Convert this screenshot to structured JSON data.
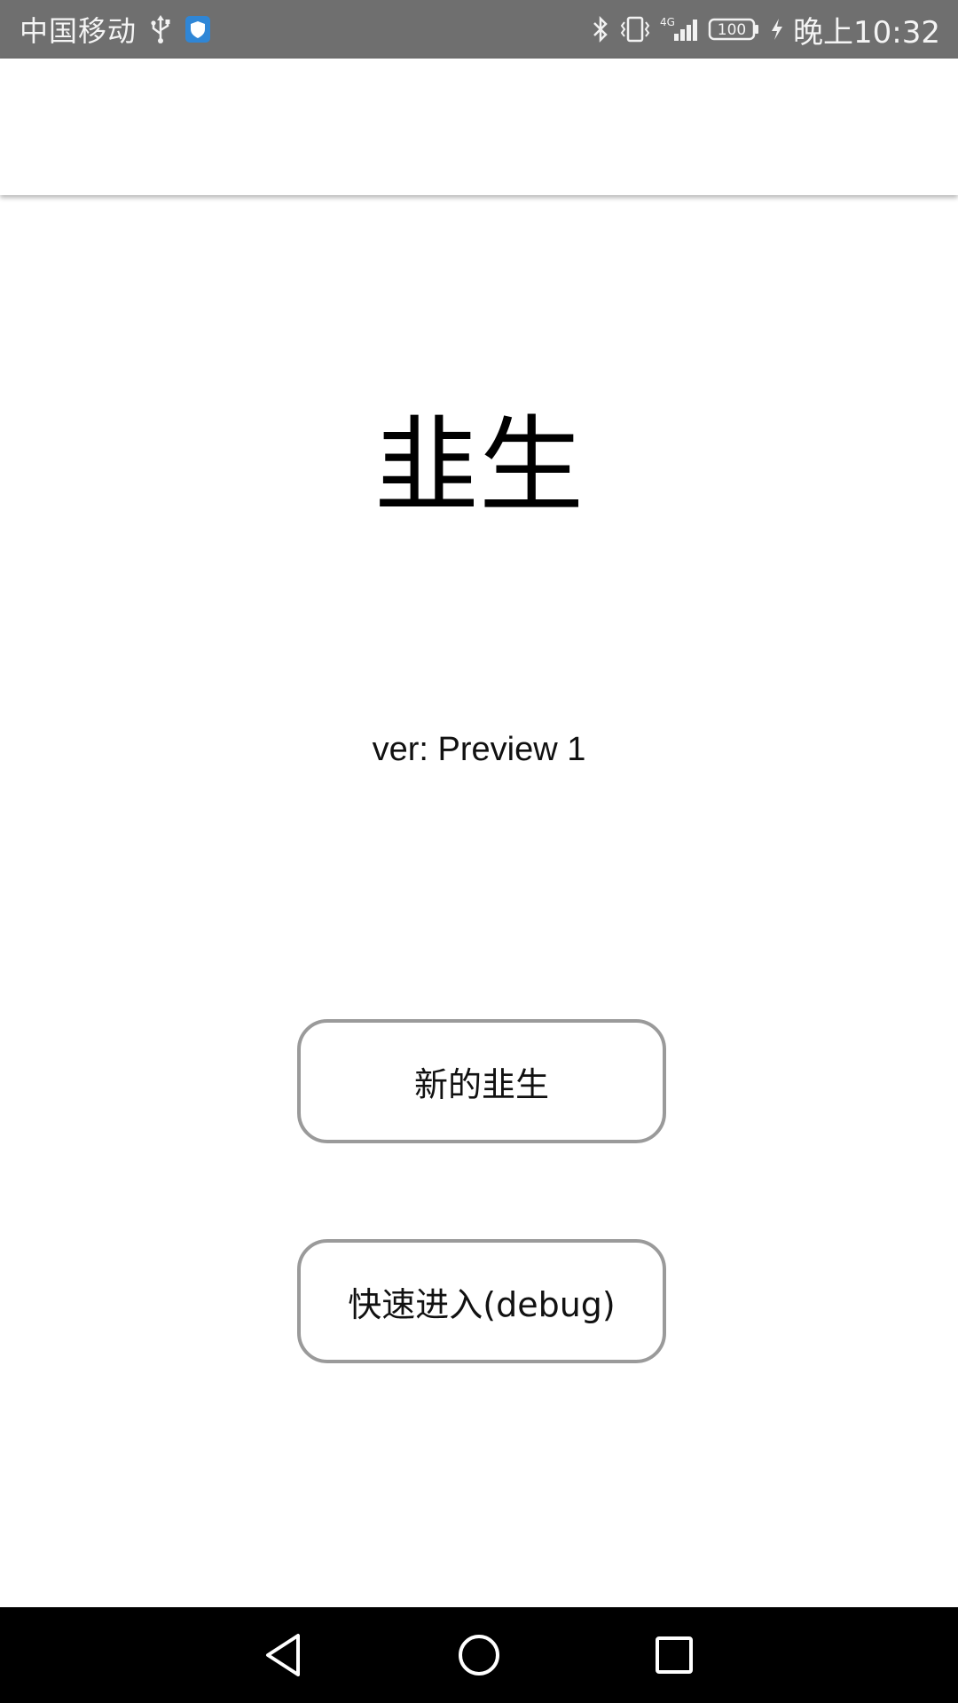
{
  "status_bar": {
    "carrier": "中国移动",
    "network_label": "4G",
    "battery_level": "100",
    "time": "晚上10:32",
    "icons": [
      "usb-icon",
      "shield-icon",
      "bluetooth-icon",
      "vibrate-icon",
      "signal-icon",
      "battery-icon",
      "charging-icon"
    ],
    "shield_color": "#2f86d6"
  },
  "main": {
    "title": "韭生",
    "version": "ver: Preview 1"
  },
  "buttons": {
    "new_game_label": "新的韭生",
    "quick_enter_label": "快速进入(debug)"
  },
  "nav_bar": {
    "icons": [
      "back-icon",
      "home-icon",
      "recent-apps-icon"
    ]
  }
}
